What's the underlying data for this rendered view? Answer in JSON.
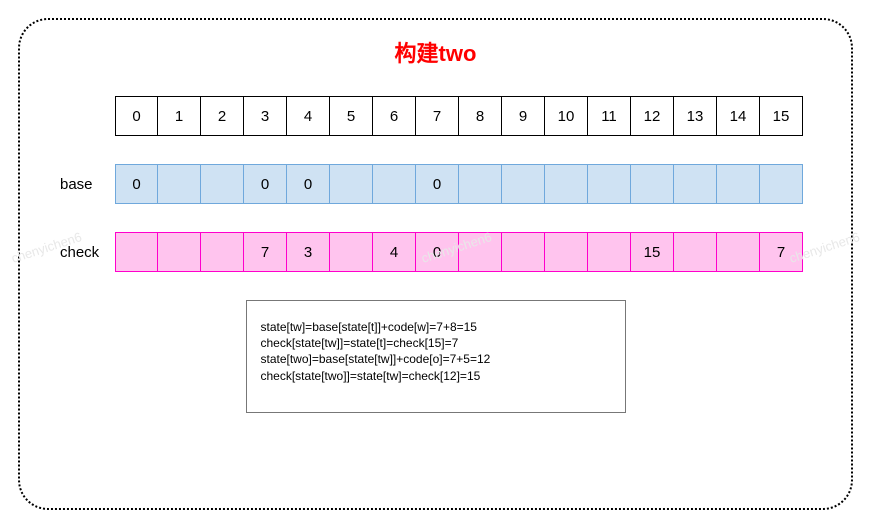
{
  "title": "构建two",
  "labels": {
    "base": "base",
    "check": "check"
  },
  "chart_data": {
    "type": "table",
    "index": [
      "0",
      "1",
      "2",
      "3",
      "4",
      "5",
      "6",
      "7",
      "8",
      "9",
      "10",
      "11",
      "12",
      "13",
      "14",
      "15"
    ],
    "base": [
      "0",
      "",
      "",
      "0",
      "0",
      "",
      "",
      "0",
      "",
      "",
      "",
      "",
      "",
      "",
      "",
      ""
    ],
    "check": [
      "",
      "",
      "",
      "7",
      "3",
      "",
      "4",
      "0",
      "",
      "",
      "",
      "",
      "15",
      "",
      "",
      "7"
    ]
  },
  "formulas": [
    "state[tw]=base[state[t]]+code[w]=7+8=15",
    "check[state[tw]]=state[t]=check[15]=7",
    "state[two]=base[state[tw]]+code[o]=7+5=12",
    "check[state[two]]=state[tw]=check[12]=15"
  ],
  "watermark": "chenyichen6"
}
